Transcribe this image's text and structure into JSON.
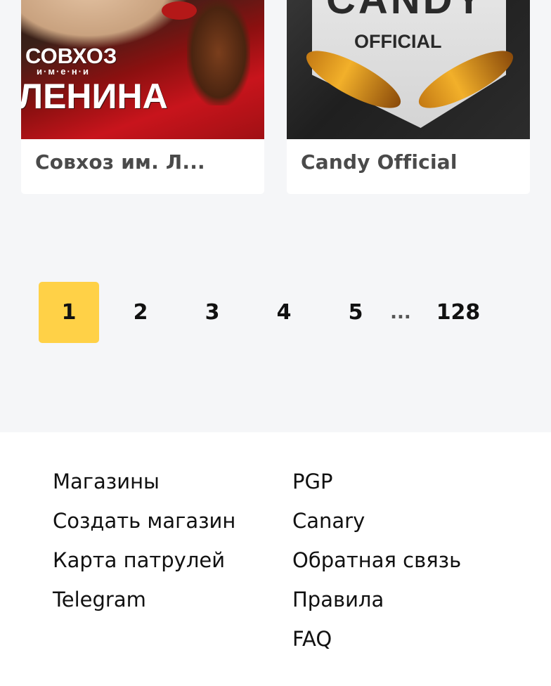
{
  "shops": [
    {
      "title": "Совхоз им. Л...",
      "image": {
        "line1": "СОВХОЗ",
        "line2": "и·м·е·н·и",
        "line3": "ЛЕНИНА"
      }
    },
    {
      "title": "Candy Official",
      "image": {
        "line1": "CANDY",
        "line2": "OFFICIAL"
      }
    }
  ],
  "pagination": {
    "current": 1,
    "pages": [
      "1",
      "2",
      "3",
      "4",
      "5"
    ],
    "ellipsis": "...",
    "last": "128",
    "active_color": "#ffd147"
  },
  "footer": {
    "left_links": [
      "Магазины",
      "Создать магазин",
      "Карта патрулей",
      "Telegram"
    ],
    "right_links": [
      "PGP",
      "Canary",
      "Обратная связь",
      "Правила",
      "FAQ"
    ]
  }
}
